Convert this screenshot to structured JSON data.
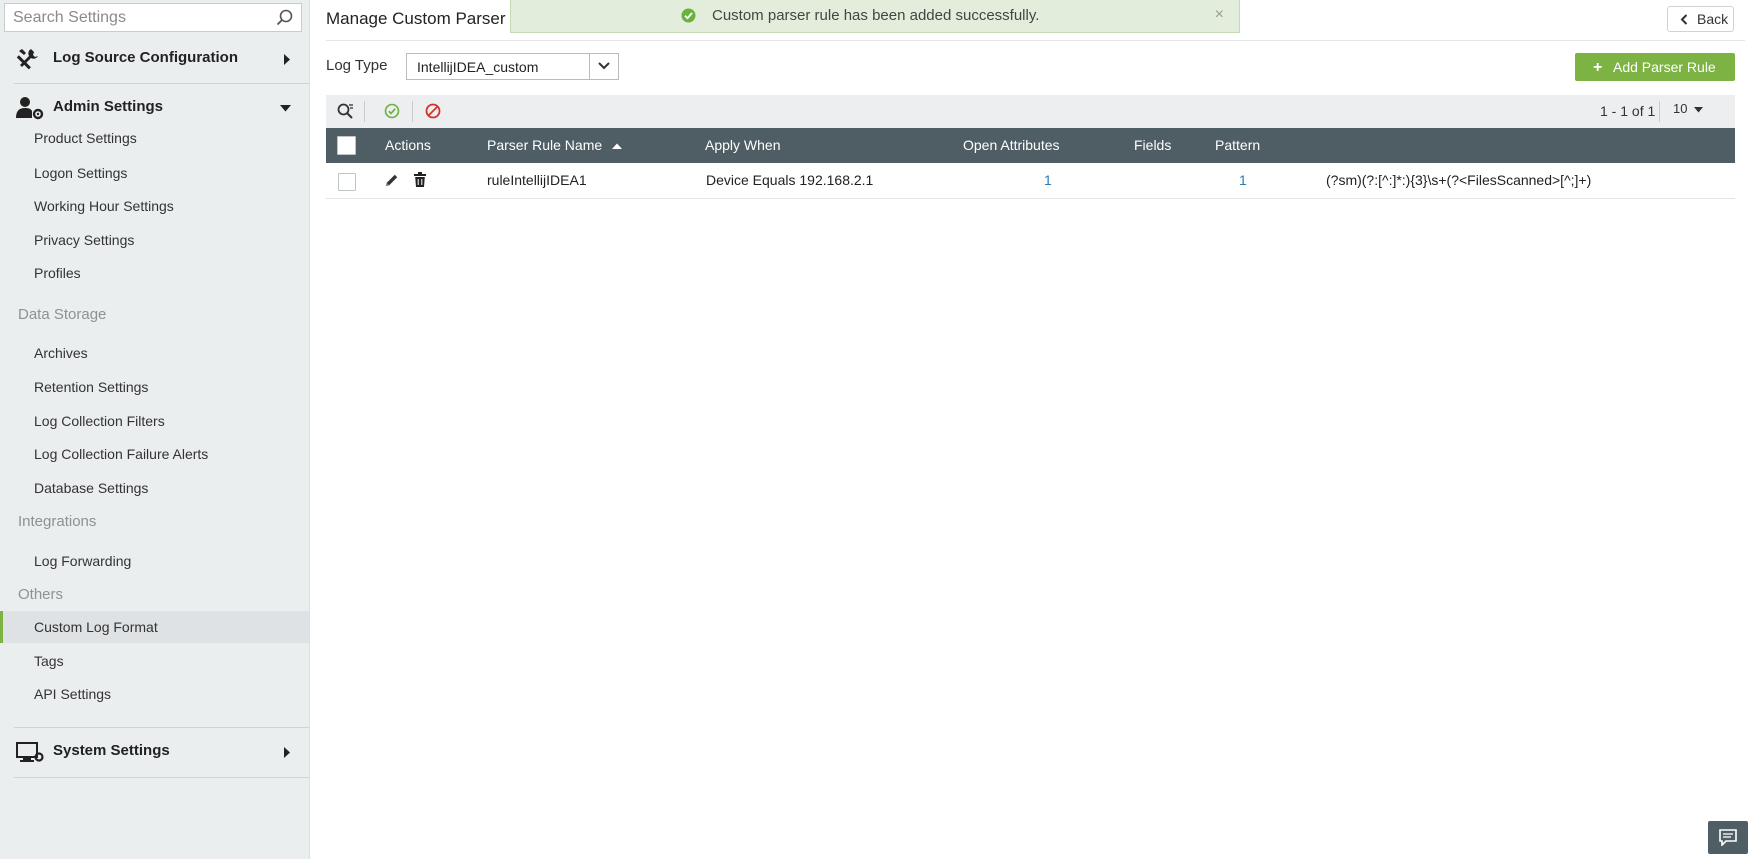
{
  "search": {
    "placeholder": "Search Settings"
  },
  "sidebar": {
    "log_source": {
      "label": "Log Source Configuration"
    },
    "admin": {
      "label": "Admin Settings"
    },
    "admin_items": [
      {
        "label": "Product Settings"
      },
      {
        "label": "Logon Settings"
      },
      {
        "label": "Working Hour Settings"
      },
      {
        "label": "Privacy Settings"
      },
      {
        "label": "Profiles"
      }
    ],
    "groups": [
      {
        "title": "Data Storage",
        "items": [
          {
            "label": "Archives"
          },
          {
            "label": "Retention Settings"
          },
          {
            "label": "Log Collection Filters"
          },
          {
            "label": "Log Collection Failure Alerts"
          },
          {
            "label": "Database Settings"
          }
        ]
      },
      {
        "title": "Integrations",
        "items": [
          {
            "label": "Log Forwarding"
          }
        ]
      },
      {
        "title": "Others",
        "items": [
          {
            "label": "Custom Log Format"
          },
          {
            "label": "Tags"
          },
          {
            "label": "API Settings"
          }
        ]
      }
    ],
    "active_item": "Custom Log Format",
    "system": {
      "label": "System Settings"
    }
  },
  "main": {
    "title": "Manage Custom Parser",
    "toast": {
      "message": "Custom parser rule has been added successfully.",
      "close": "×"
    },
    "back_label": "Back",
    "log_type_label": "Log Type",
    "log_type_value": "IntellijIDEA_custom",
    "add_button": {
      "plus": "+",
      "label": "Add Parser Rule"
    },
    "pager": "1 - 1 of 1",
    "per_page": "10",
    "table": {
      "headers": {
        "actions": "Actions",
        "name": "Parser Rule Name",
        "apply_when": "Apply When",
        "open_attributes": "Open Attributes",
        "fields": "Fields",
        "pattern": "Pattern"
      },
      "rows": [
        {
          "name": "ruleIntellijIDEA1",
          "apply_when": "Device Equals 192.168.2.1",
          "open_attributes": "1",
          "fields": "1",
          "pattern": "(?sm)(?:[^:]*:){3}\\s+(?<FilesScanned>[^;]+)"
        }
      ]
    }
  },
  "colors": {
    "accent_green": "#7cb342",
    "table_header": "#4f5d64",
    "link": "#2a7bb8",
    "toast_bg": "#e2eedb"
  }
}
